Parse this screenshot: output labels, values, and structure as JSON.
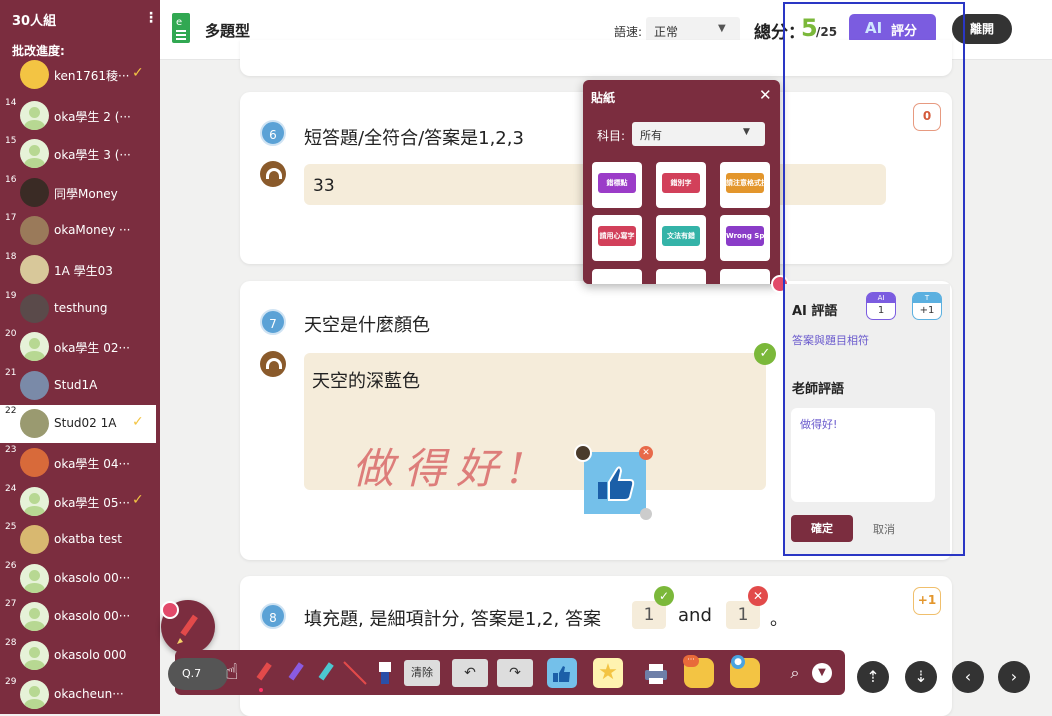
{
  "sidebar": {
    "title": "30人組",
    "menu": "⋮",
    "progress_label": "批改進度:",
    "students": [
      {
        "num": "",
        "name": "ken1761稜···",
        "checked": true
      },
      {
        "num": "14",
        "name": "oka學生 2 (···",
        "checked": false
      },
      {
        "num": "15",
        "name": "oka學生 3 (···",
        "checked": false
      },
      {
        "num": "16",
        "name": "同學Money",
        "checked": false
      },
      {
        "num": "17",
        "name": "okaMoney ···",
        "checked": false
      },
      {
        "num": "18",
        "name": "1A 學生03",
        "checked": false
      },
      {
        "num": "19",
        "name": "testhung",
        "checked": false
      },
      {
        "num": "20",
        "name": "oka學生 02···",
        "checked": false
      },
      {
        "num": "21",
        "name": "Stud1A",
        "checked": false
      },
      {
        "num": "22",
        "name": "Stud02 1A",
        "checked": true
      },
      {
        "num": "23",
        "name": "oka學生 04···",
        "checked": false
      },
      {
        "num": "24",
        "name": "oka學生 05···",
        "checked": true
      },
      {
        "num": "25",
        "name": "okatba test",
        "checked": false
      },
      {
        "num": "26",
        "name": "okasolo 00···",
        "checked": false
      },
      {
        "num": "27",
        "name": "okasolo 00···",
        "checked": false
      },
      {
        "num": "28",
        "name": "okasolo 000",
        "checked": false
      },
      {
        "num": "29",
        "name": "okacheun···",
        "checked": false
      }
    ]
  },
  "header": {
    "doc_title": "多題型",
    "speed_label": "語速:",
    "speed_value": "正常",
    "total_label": "總分：",
    "score": "5",
    "score_total": "/25",
    "ai_button": "評分",
    "ai_logo": "AI",
    "leave_button": "離開"
  },
  "questions": [
    {
      "num": "6",
      "text": "短答題/全符合/答案是1,2,3",
      "answer": "33",
      "score": "0"
    },
    {
      "num": "7",
      "text": "天空是什麼顏色",
      "answer": "天空的深藍色",
      "handwriting": "做得好!"
    },
    {
      "num": "8",
      "text_a": "填充題, 是細項計分, 答案是1,2, 答案",
      "blank1": "1",
      "text_b": "and",
      "blank2": "1",
      "text_c": "。",
      "score": "+1"
    }
  ],
  "sticker_panel": {
    "title": "貼紙",
    "close": "✕",
    "subject_label": "科目:",
    "subject_value": "所有",
    "stickers": [
      {
        "text": "錯標點",
        "color": "#9b3cc8"
      },
      {
        "text": "錯別字",
        "color": "#d2405a"
      },
      {
        "text": "請注意格式抄寫",
        "color": "#e3962c"
      },
      {
        "text": "請用心寫字",
        "color": "#d2405a"
      },
      {
        "text": "文法有錯",
        "color": "#34b3a8"
      },
      {
        "text": "Wrong Spelling",
        "color": "#8a3cc8"
      }
    ]
  },
  "ai_comment": {
    "title": "AI 評語",
    "badge_ai_top": "AI",
    "badge_ai_val": "1",
    "badge_t_top": "T",
    "badge_t_val": "+1",
    "ai_text": "答案與題目相符",
    "teacher_title": "老師評語",
    "teacher_text": "做得好!",
    "confirm": "確定",
    "cancel": "取消"
  },
  "toolbar": {
    "question_label": "Q.7",
    "clear_label": "清除"
  },
  "colors": {
    "sidebar": "#7b2d3f",
    "accent": "#7b2d3f",
    "ai_button": "#7b5ce0",
    "highlight_border": "#2a36c4",
    "score_green": "#7bb83a"
  }
}
